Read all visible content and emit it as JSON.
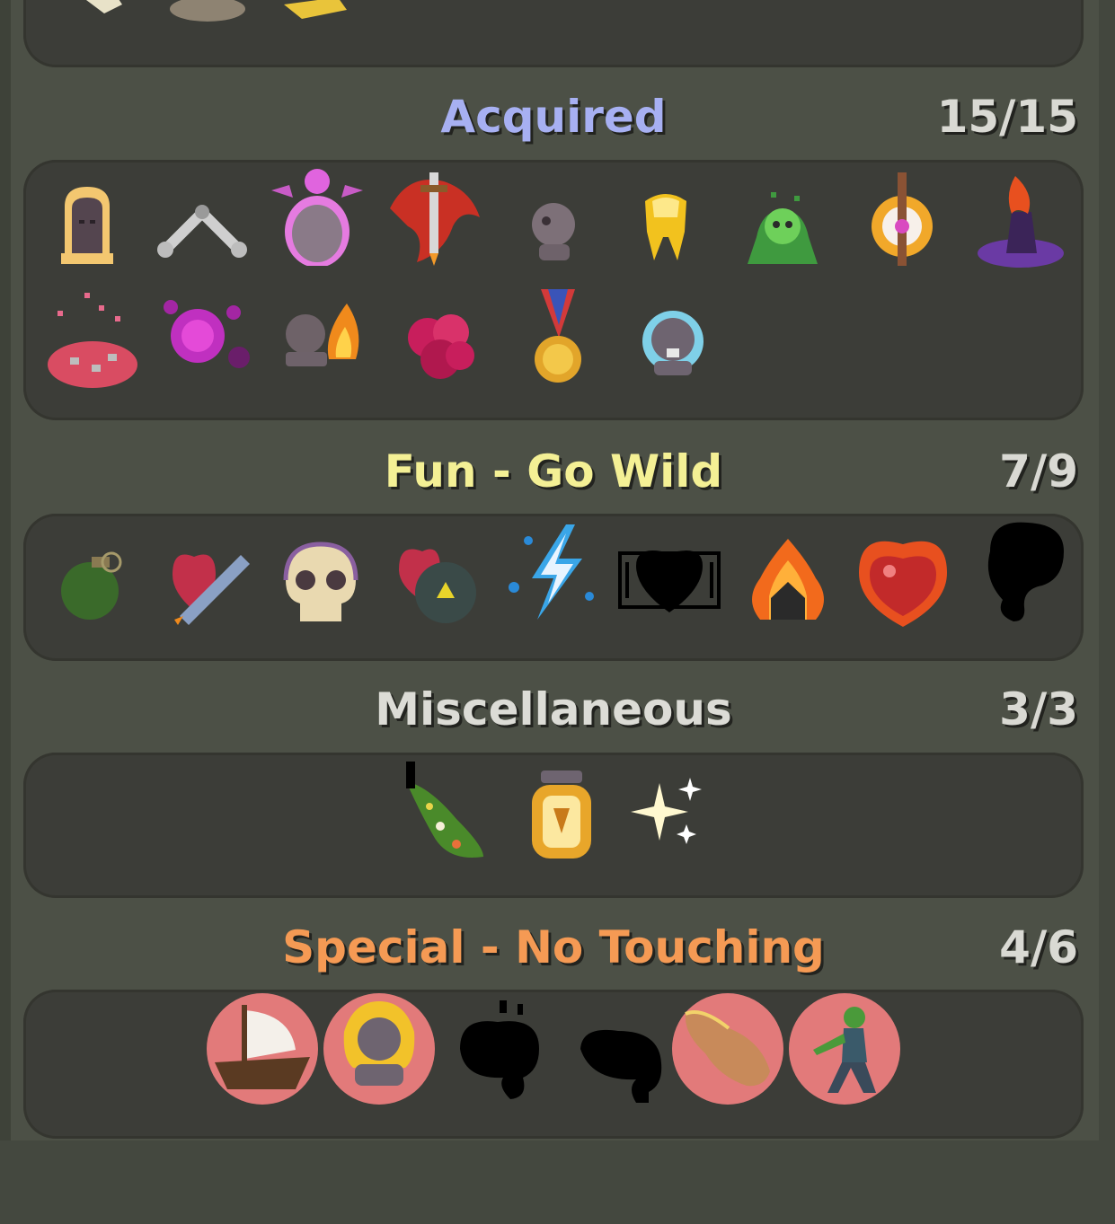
{
  "sections": {
    "acquired": {
      "title": "Acquired",
      "count": "15/15",
      "color": "#a7b0f2",
      "icons": [
        "golden-haired-head-icon",
        "crossed-bones-icon",
        "pink-ghost-bust-icon",
        "red-dragon-sword-icon",
        "small-stone-bust-icon",
        "golden-tooth-icon",
        "green-goblin-icon",
        "golden-sword-amulet-icon",
        "purple-flame-cloak-icon",
        "pink-spore-mushroom-icon",
        "purple-virus-icon",
        "burning-stone-bust-icon",
        "crimson-berry-cluster-icon",
        "gold-medal-icon",
        "blue-aura-bust-icon"
      ]
    },
    "fun": {
      "title": "Fun - Go Wild",
      "count": "7/9",
      "color": "#f4f095",
      "icons": [
        "green-grenade-icon",
        "heart-rocket-icon",
        "skull-icon",
        "heart-bomb-icon",
        "lightning-bolt-icon",
        "locked-heart-silhouette-icon",
        "flaming-house-icon",
        "flaming-heart-icon",
        "locked-silhouette-icon"
      ]
    },
    "misc": {
      "title": "Miscellaneous",
      "count": "3/3",
      "color": "#dcdcd6",
      "icons": [
        "flower-sleeve-icon",
        "golden-lantern-icon",
        "sparkle-icon"
      ]
    },
    "special": {
      "title": "Special - No Touching",
      "count": "4/6",
      "color": "#f59a54",
      "icons": [
        "sailing-ship-icon",
        "golden-aura-bust-icon",
        "locked-silhouette-icon",
        "locked-silhouette-icon",
        "pointing-hand-icon",
        "green-zombie-icon"
      ]
    }
  }
}
